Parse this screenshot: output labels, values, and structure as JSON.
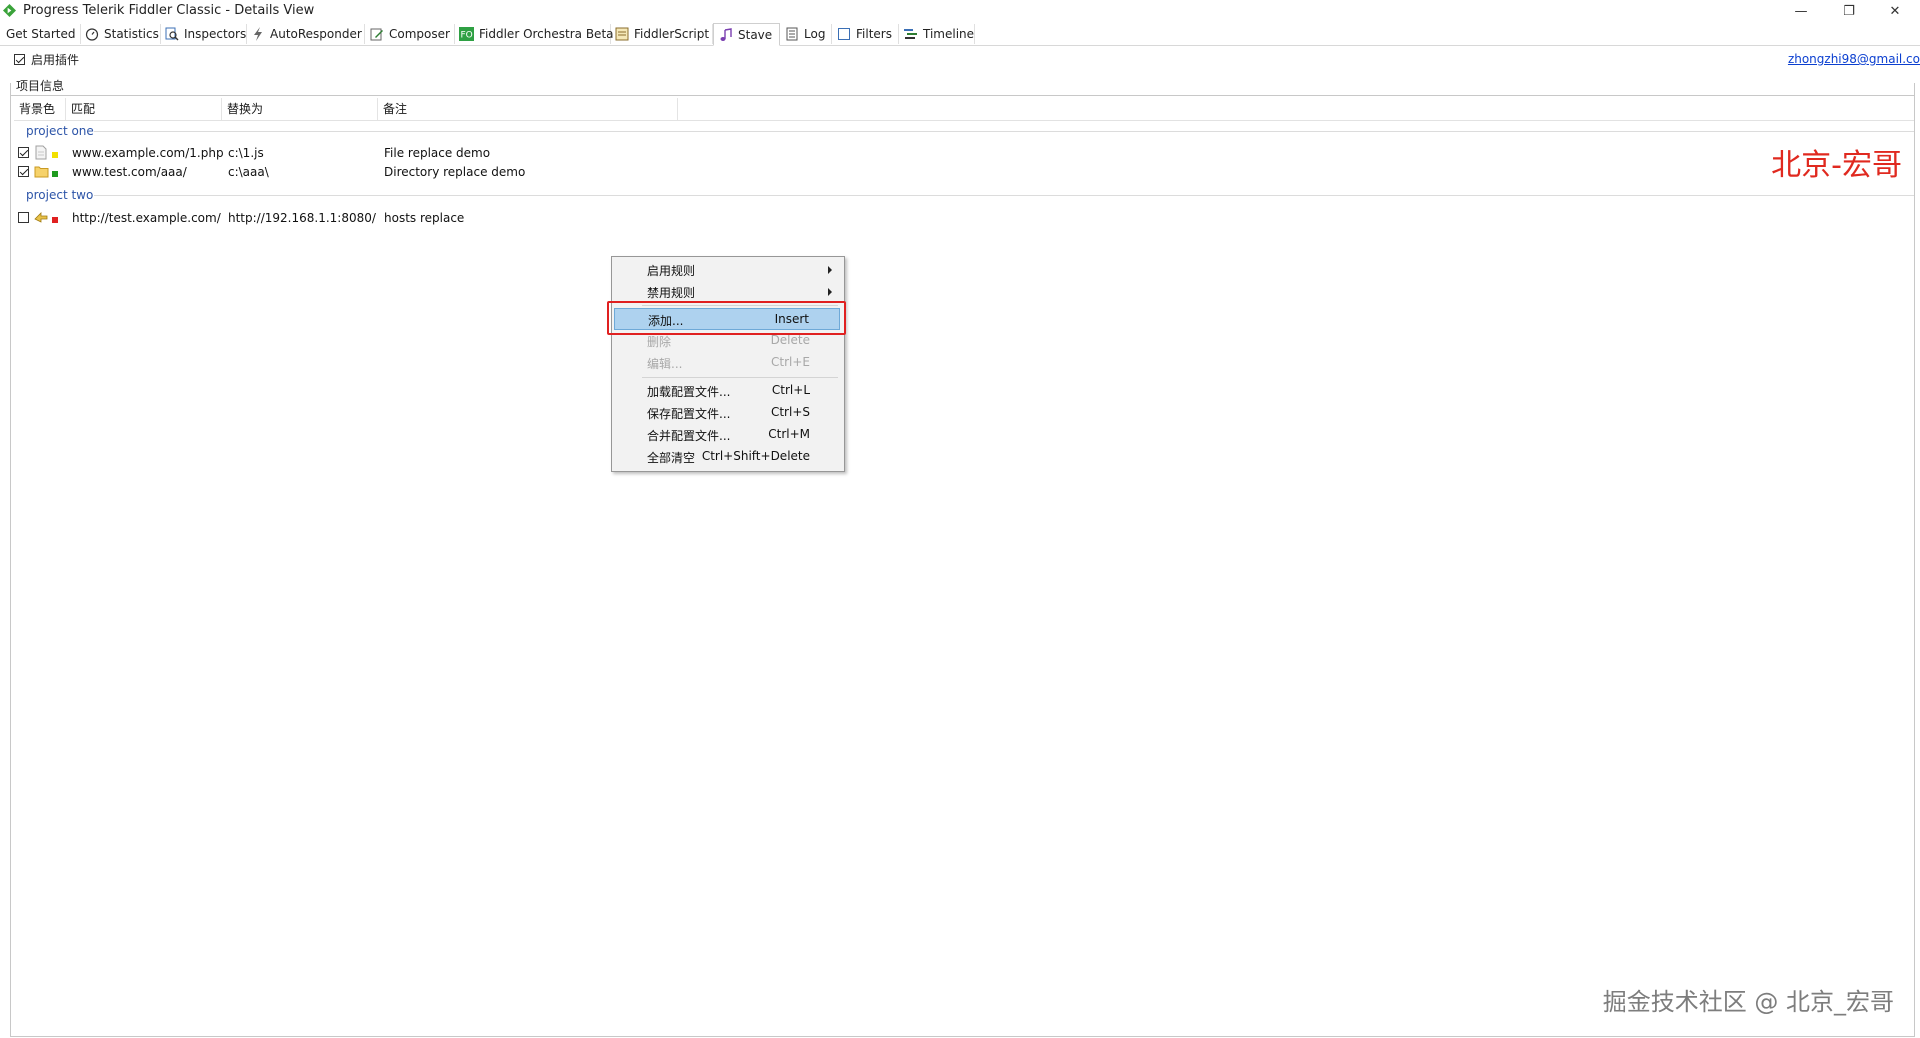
{
  "window": {
    "title": "Progress Telerik Fiddler Classic - Details View",
    "minimize_glyph": "—",
    "restore_glyph": "❐",
    "close_glyph": "✕"
  },
  "tabs": [
    {
      "label": "Get Started",
      "icon": "none"
    },
    {
      "label": "Statistics",
      "icon": "stopwatch-icon"
    },
    {
      "label": "Inspectors",
      "icon": "inspector-icon"
    },
    {
      "label": "AutoResponder",
      "icon": "lightning-icon"
    },
    {
      "label": "Composer",
      "icon": "pencil-icon"
    },
    {
      "label": "Fiddler Orchestra Beta",
      "icon": "fo-icon"
    },
    {
      "label": "FiddlerScript",
      "icon": "script-icon"
    },
    {
      "label": "Stave",
      "icon": "music-note-icon"
    },
    {
      "label": "Log",
      "icon": "log-icon"
    },
    {
      "label": "Filters",
      "icon": "checkbox-icon"
    },
    {
      "label": "Timeline",
      "icon": "timeline-icon"
    }
  ],
  "active_tab": "Stave",
  "plugin": {
    "enable_label": "启用插件",
    "enabled": true,
    "email": "zhongzhi98@gmail.co"
  },
  "group_box_label": "项目信息",
  "columns": {
    "bg": "背景色",
    "match": "匹配",
    "replace": "替换为",
    "note": "备注"
  },
  "groups": [
    {
      "name": "project one",
      "rows": [
        {
          "checked": true,
          "icon": "file-icon",
          "color": "#f2e000",
          "match": "www.example.com/1.php",
          "replace": "c:\\1.js",
          "note": "File replace demo"
        },
        {
          "checked": true,
          "icon": "folder-icon",
          "color": "#1e9a1e",
          "match": "www.test.com/aaa/",
          "replace": "c:\\aaa\\",
          "note": "Directory replace demo"
        }
      ]
    },
    {
      "name": "project two",
      "rows": [
        {
          "checked": false,
          "icon": "arrow-swap-icon",
          "color": "#e02020",
          "match": "http://test.example.com/",
          "replace": "http://192.168.1.1:8080/",
          "note": "hosts replace"
        }
      ]
    }
  ],
  "context_menu": {
    "enable_rules": "启用规则",
    "disable_rules": "禁用规则",
    "add": {
      "label": "添加...",
      "key": "Insert"
    },
    "delete": {
      "label": "删除",
      "key": "Delete"
    },
    "edit": {
      "label": "编辑...",
      "key": "Ctrl+E"
    },
    "load": {
      "label": "加载配置文件...",
      "key": "Ctrl+L"
    },
    "save": {
      "label": "保存配置文件...",
      "key": "Ctrl+S"
    },
    "merge": {
      "label": "合并配置文件...",
      "key": "Ctrl+M"
    },
    "clear": {
      "label": "全部清空",
      "key": "Ctrl+Shift+Delete"
    }
  },
  "watermarks": {
    "top_right": "北京-宏哥",
    "bottom_right": "掘金技术社区 @ 北京_宏哥"
  },
  "colors": {
    "highlight": "#aed2ef",
    "annotation_red": "#e02020",
    "group_header": "#2c54a8",
    "link": "#0b3fd0"
  }
}
